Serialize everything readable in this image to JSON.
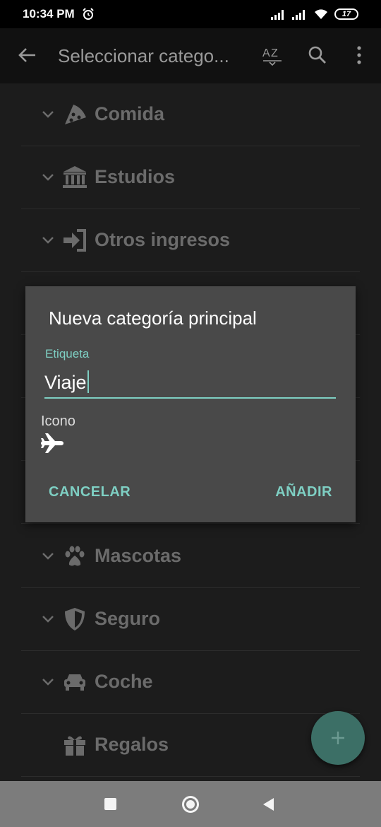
{
  "status_bar": {
    "time": "10:34 PM",
    "battery": "17"
  },
  "app_bar": {
    "title": "Seleccionar catego...",
    "icons": [
      "back-arrow-icon",
      "sort-az-icon",
      "search-icon",
      "more-vert-icon"
    ]
  },
  "categories": [
    {
      "label": "Comida",
      "icon": "pizza-icon",
      "expandable": true
    },
    {
      "label": "Estudios",
      "icon": "bank-icon",
      "expandable": true
    },
    {
      "label": "Otros ingresos",
      "icon": "sign-in-icon",
      "expandable": true
    },
    {
      "label": "Mascotas",
      "icon": "paw-icon",
      "expandable": true
    },
    {
      "label": "Seguro",
      "icon": "shield-icon",
      "expandable": true
    },
    {
      "label": "Coche",
      "icon": "car-icon",
      "expandable": true
    },
    {
      "label": "Regalos",
      "icon": "gift-icon",
      "expandable": false
    }
  ],
  "dialog": {
    "title": "Nueva categoría principal",
    "field_label": "Etiqueta",
    "field_value": "Viaje",
    "icon_label": "Icono",
    "icon": "airplane-icon",
    "cancel_label": "CANCELAR",
    "add_label": "AÑADIR"
  },
  "colors": {
    "accent": "#7ecfc3",
    "dialog_bg": "#494949",
    "fab": "#3c6f66"
  }
}
